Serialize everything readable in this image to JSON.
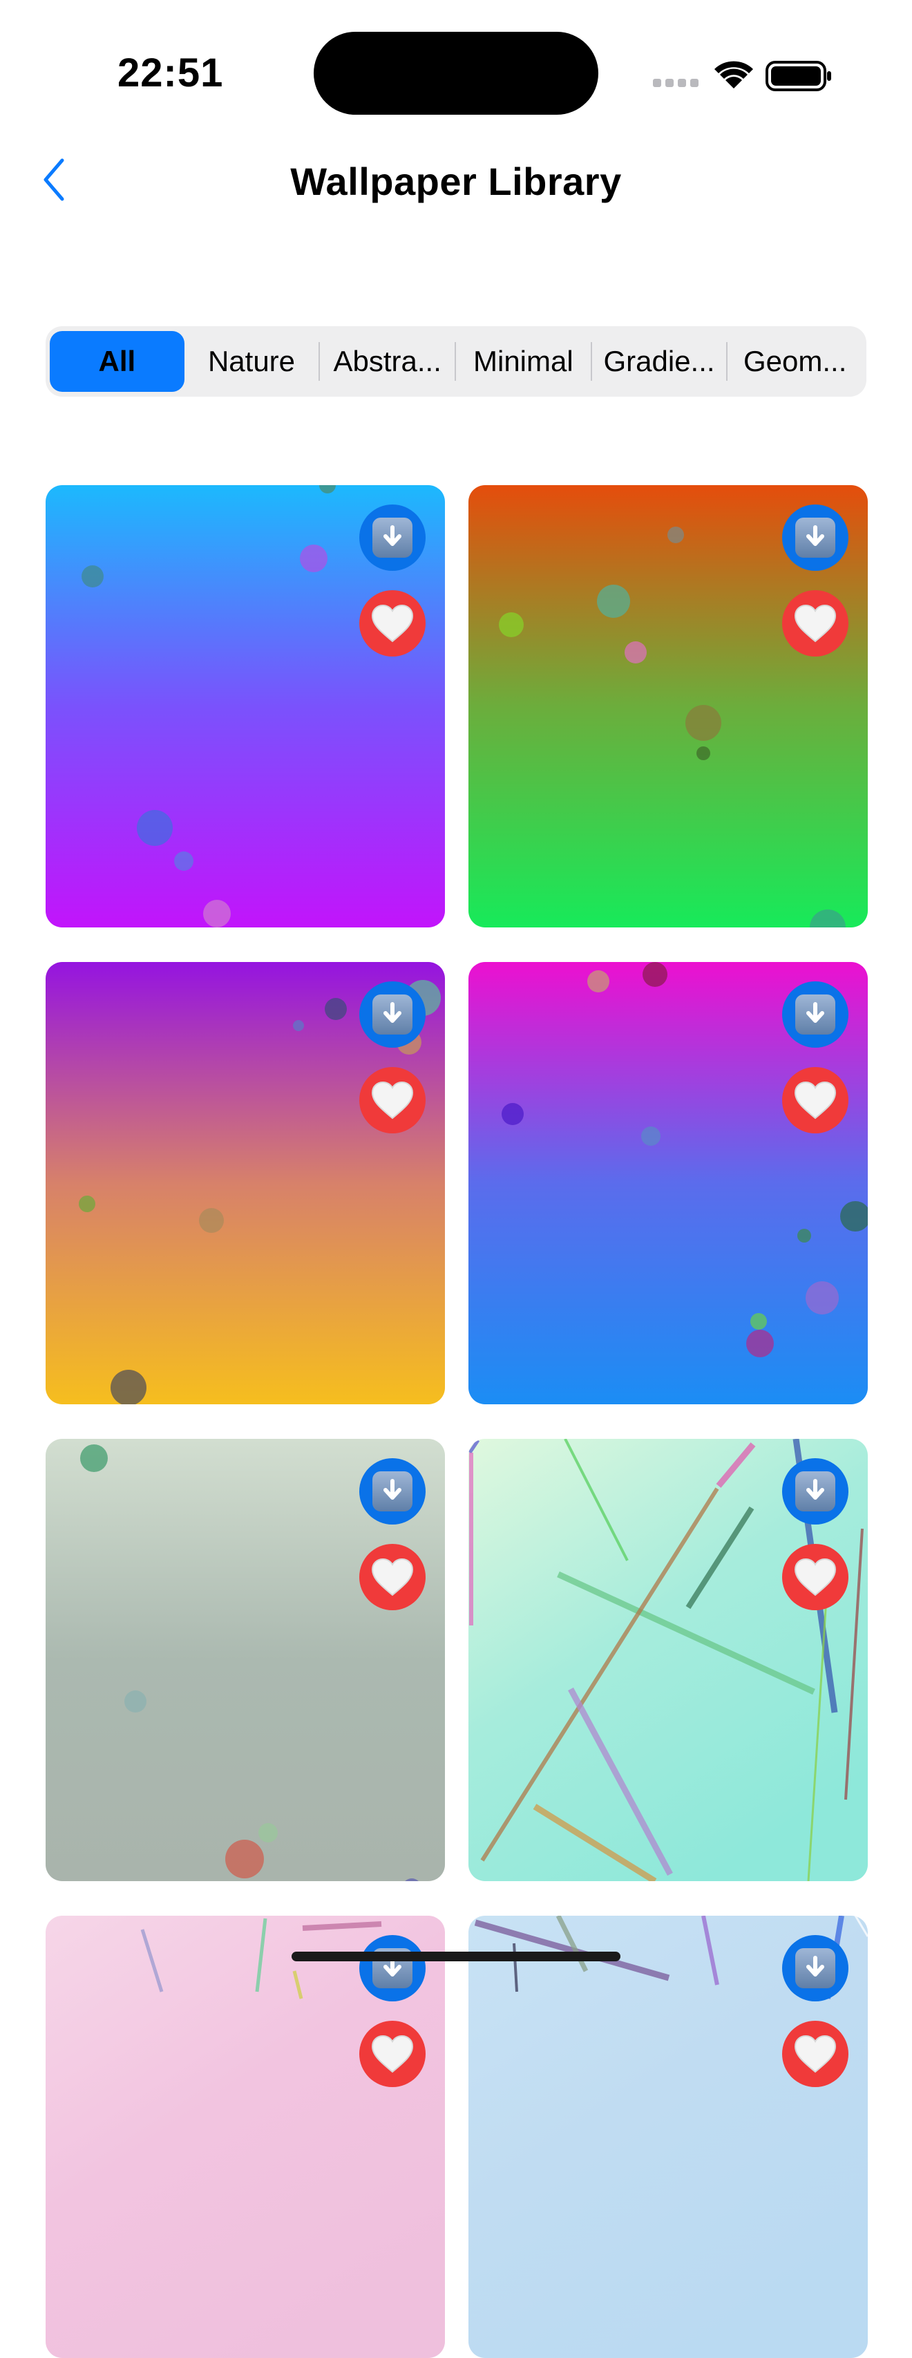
{
  "status_bar": {
    "time": "22:51"
  },
  "nav": {
    "title": "Wallpaper Library"
  },
  "categories": [
    "All",
    "Nature",
    "Abstra...",
    "Minimal",
    "Gradie...",
    "Geom..."
  ],
  "selected_category": "All",
  "wallpapers": [
    {
      "style": "gradient",
      "colors": [
        "#1cb9fd",
        "#7a52fc",
        "#c214fb"
      ]
    },
    {
      "style": "gradient",
      "colors": [
        "#e54d0c",
        "#6cad3c",
        "#17ea5a"
      ]
    },
    {
      "style": "gradient",
      "colors": [
        "#9514e0",
        "#d7816a",
        "#f6be1e"
      ]
    },
    {
      "style": "gradient",
      "colors": [
        "#ec10d0",
        "#5b6cec",
        "#1b8df4"
      ]
    },
    {
      "style": "gradient",
      "colors": [
        "#d2ded0",
        "#abb9b0",
        "#a9b4ac"
      ]
    },
    {
      "style": "lines",
      "colors": [
        "#e0f8de",
        "#a6ecdc",
        "#8ee8da"
      ]
    },
    {
      "style": "lines",
      "colors": [
        "#f6d6e8",
        "#f2c4e0",
        "#efc0dd"
      ]
    },
    {
      "style": "lines",
      "colors": [
        "#c8e2f4",
        "#c0dcf2",
        "#badaf2"
      ]
    }
  ],
  "colors": {
    "accent": "#0a7bff",
    "download": "#0a72e8",
    "favorite": "#f03a3a"
  },
  "icons": {
    "back": "chevron-left-icon",
    "download": "download-icon",
    "favorite": "heart-icon"
  }
}
